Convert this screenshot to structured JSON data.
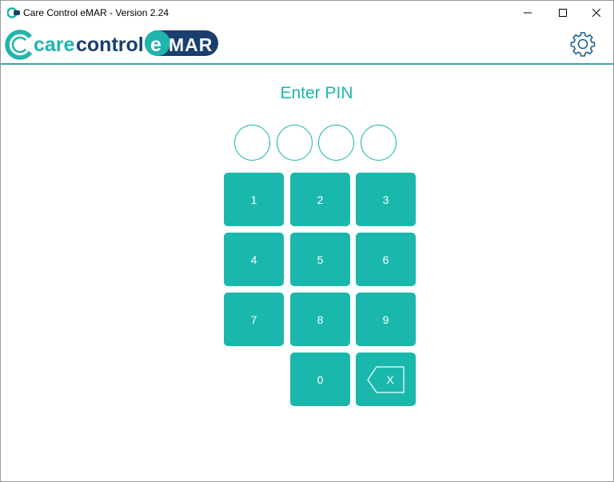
{
  "window": {
    "title": "Care Control eMAR - Version 2.24",
    "controls": [
      "minimize-icon",
      "maximize-icon",
      "close-icon"
    ]
  },
  "header": {
    "logo_text_care": "care",
    "logo_text_control": "control",
    "logo_badge": "eMAR",
    "settings_icon": "gear-icon"
  },
  "pin": {
    "title": "Enter PIN",
    "digits_total": 4,
    "digits_entered": 0
  },
  "keypad": {
    "keys": [
      "1",
      "2",
      "3",
      "4",
      "5",
      "6",
      "7",
      "8",
      "9",
      "0"
    ],
    "backspace_label": "X"
  },
  "colors": {
    "accent": "#1ab8ac",
    "brand_teal": "#1fb5ad",
    "brand_dark": "#1a3e6e",
    "header_border": "#3fa8b1"
  }
}
